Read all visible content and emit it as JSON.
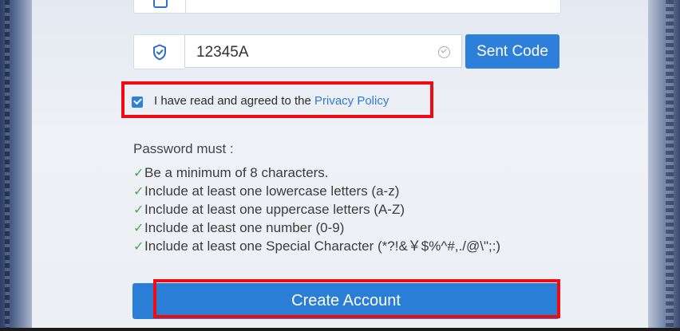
{
  "code_row": {
    "value": "12345A",
    "button_label": "Sent Code"
  },
  "agree": {
    "text": "I have read and agreed to the ",
    "link": "Privacy Policy",
    "checked": true
  },
  "password": {
    "title": "Password must :",
    "tick": "✓",
    "rules": [
      "Be a minimum of 8 characters.",
      "Include at least one lowercase letters (a-z)",
      "Include at least one uppercase letters (A-Z)",
      "Include at least one number (0-9)",
      "Include at least one Special Character (*?!&￥$%^#,./@\\\";:)"
    ]
  },
  "create_button": "Create Account",
  "colors": {
    "accent": "#2e7fd9",
    "highlight": "#f00a12",
    "tick": "#4aa84a",
    "link": "#2f7ad6"
  },
  "icons": {
    "shield": "shield-check-icon",
    "valid": "check-circle-icon",
    "checkbox": "checkbox-checked-icon"
  }
}
